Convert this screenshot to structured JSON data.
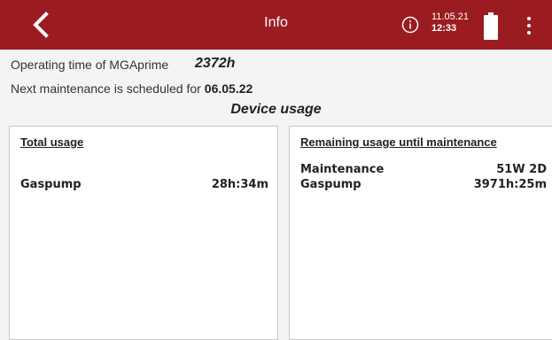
{
  "header": {
    "title": "Info",
    "date": "11.05.21",
    "time": "12:33",
    "accent_color": "#9b1c20",
    "icons": [
      "chevron-left-icon",
      "info-icon",
      "battery-icon",
      "more-vert-icon"
    ]
  },
  "summary": {
    "operating_label": "Operating time of MGAprime",
    "operating_value": "2372h",
    "maintenance_label": "Next maintenance is scheduled for",
    "maintenance_value": "06.05.22"
  },
  "section_title": "Device usage",
  "total_usage": {
    "heading": "Total usage",
    "rows": [
      {
        "label": "Gaspump",
        "value": "28h:34m"
      }
    ]
  },
  "remaining_usage": {
    "heading": "Remaining usage until maintenance",
    "rows": [
      {
        "label": "Maintenance",
        "value": "51W 2D"
      },
      {
        "label": "Gaspump",
        "value": "3971h:25m"
      }
    ]
  }
}
